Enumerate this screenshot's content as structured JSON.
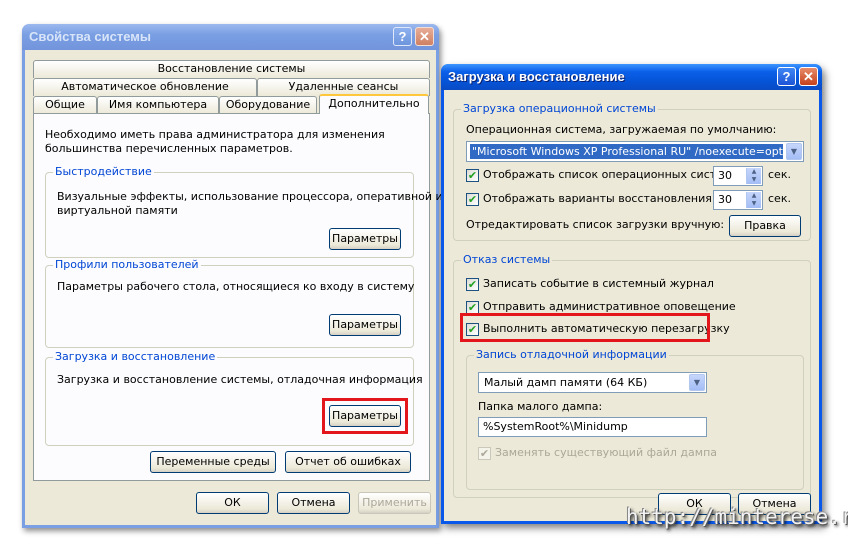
{
  "colors": {
    "title_active": "#0a58ea",
    "title_inactive": "#7a9fe3",
    "dialog_bg": "#ece9d8",
    "group_legend": "#0046d5",
    "highlight": "#e3161b"
  },
  "sysprops": {
    "title": "Свойства системы",
    "help_glyph": "?",
    "close_glyph": "✕",
    "tabs_row1": [
      "Восстановление системы"
    ],
    "tabs_row2": [
      "Автоматическое обновление",
      "Удаленные сеансы"
    ],
    "tabs_row3": [
      "Общие",
      "Имя компьютера",
      "Оборудование",
      "Дополнительно"
    ],
    "intro": [
      "Необходимо иметь права администратора для изменения",
      "большинства перечисленных параметров."
    ],
    "performance": {
      "legend": "Быстродействие",
      "desc": [
        "Визуальные эффекты, использование процессора, оперативной и",
        "виртуальной памяти"
      ],
      "button": "Параметры"
    },
    "profiles": {
      "legend": "Профили пользователей",
      "desc": "Параметры рабочего стола, относящиеся ко входу в систему",
      "button": "Параметры"
    },
    "startup": {
      "legend": "Загрузка и восстановление",
      "desc": "Загрузка и восстановление системы, отладочная информация",
      "button": "Параметры"
    },
    "env_button": "Переменные среды",
    "error_button": "Отчет об ошибках",
    "ok": "ОК",
    "cancel": "Отмена",
    "apply": "Применить"
  },
  "startup_dialog": {
    "title": "Загрузка и восстановление",
    "help_glyph": "?",
    "close_glyph": "✕",
    "boot": {
      "legend": "Загрузка операционной системы",
      "default_os_label": "Операционная система, загружаемая по умолчанию:",
      "default_os_value": "\"Microsoft Windows XP Professional RU\" /noexecute=optin /fastdetect",
      "show_os_list": {
        "label": "Отображать список операционных систем:",
        "checked": true,
        "value": "30",
        "unit": "сек."
      },
      "show_recovery": {
        "label": "Отображать варианты восстановления:",
        "checked": true,
        "value": "30",
        "unit": "сек."
      },
      "edit_label": "Отредактировать список загрузки вручную:",
      "edit_button": "Правка"
    },
    "failure": {
      "legend": "Отказ системы",
      "write_event": {
        "label": "Записать событие в системный журнал",
        "checked": true
      },
      "send_alert": {
        "label": "Отправить административное оповещение",
        "checked": true
      },
      "auto_restart": {
        "label": "Выполнить автоматическую перезагрузку",
        "checked": true
      }
    },
    "debug": {
      "legend": "Запись отладочной информации",
      "dump_type": "Малый дамп памяти (64 КБ)",
      "dump_dir_label": "Папка малого дампа:",
      "dump_dir": "%SystemRoot%\\Minidump",
      "overwrite": {
        "label": "Заменять существующий файл дампа",
        "checked": true,
        "enabled": false
      }
    },
    "ok": "ОК",
    "cancel": "Отмена"
  },
  "watermark": "http://minterese.ru/",
  "check_glyph": "✔"
}
